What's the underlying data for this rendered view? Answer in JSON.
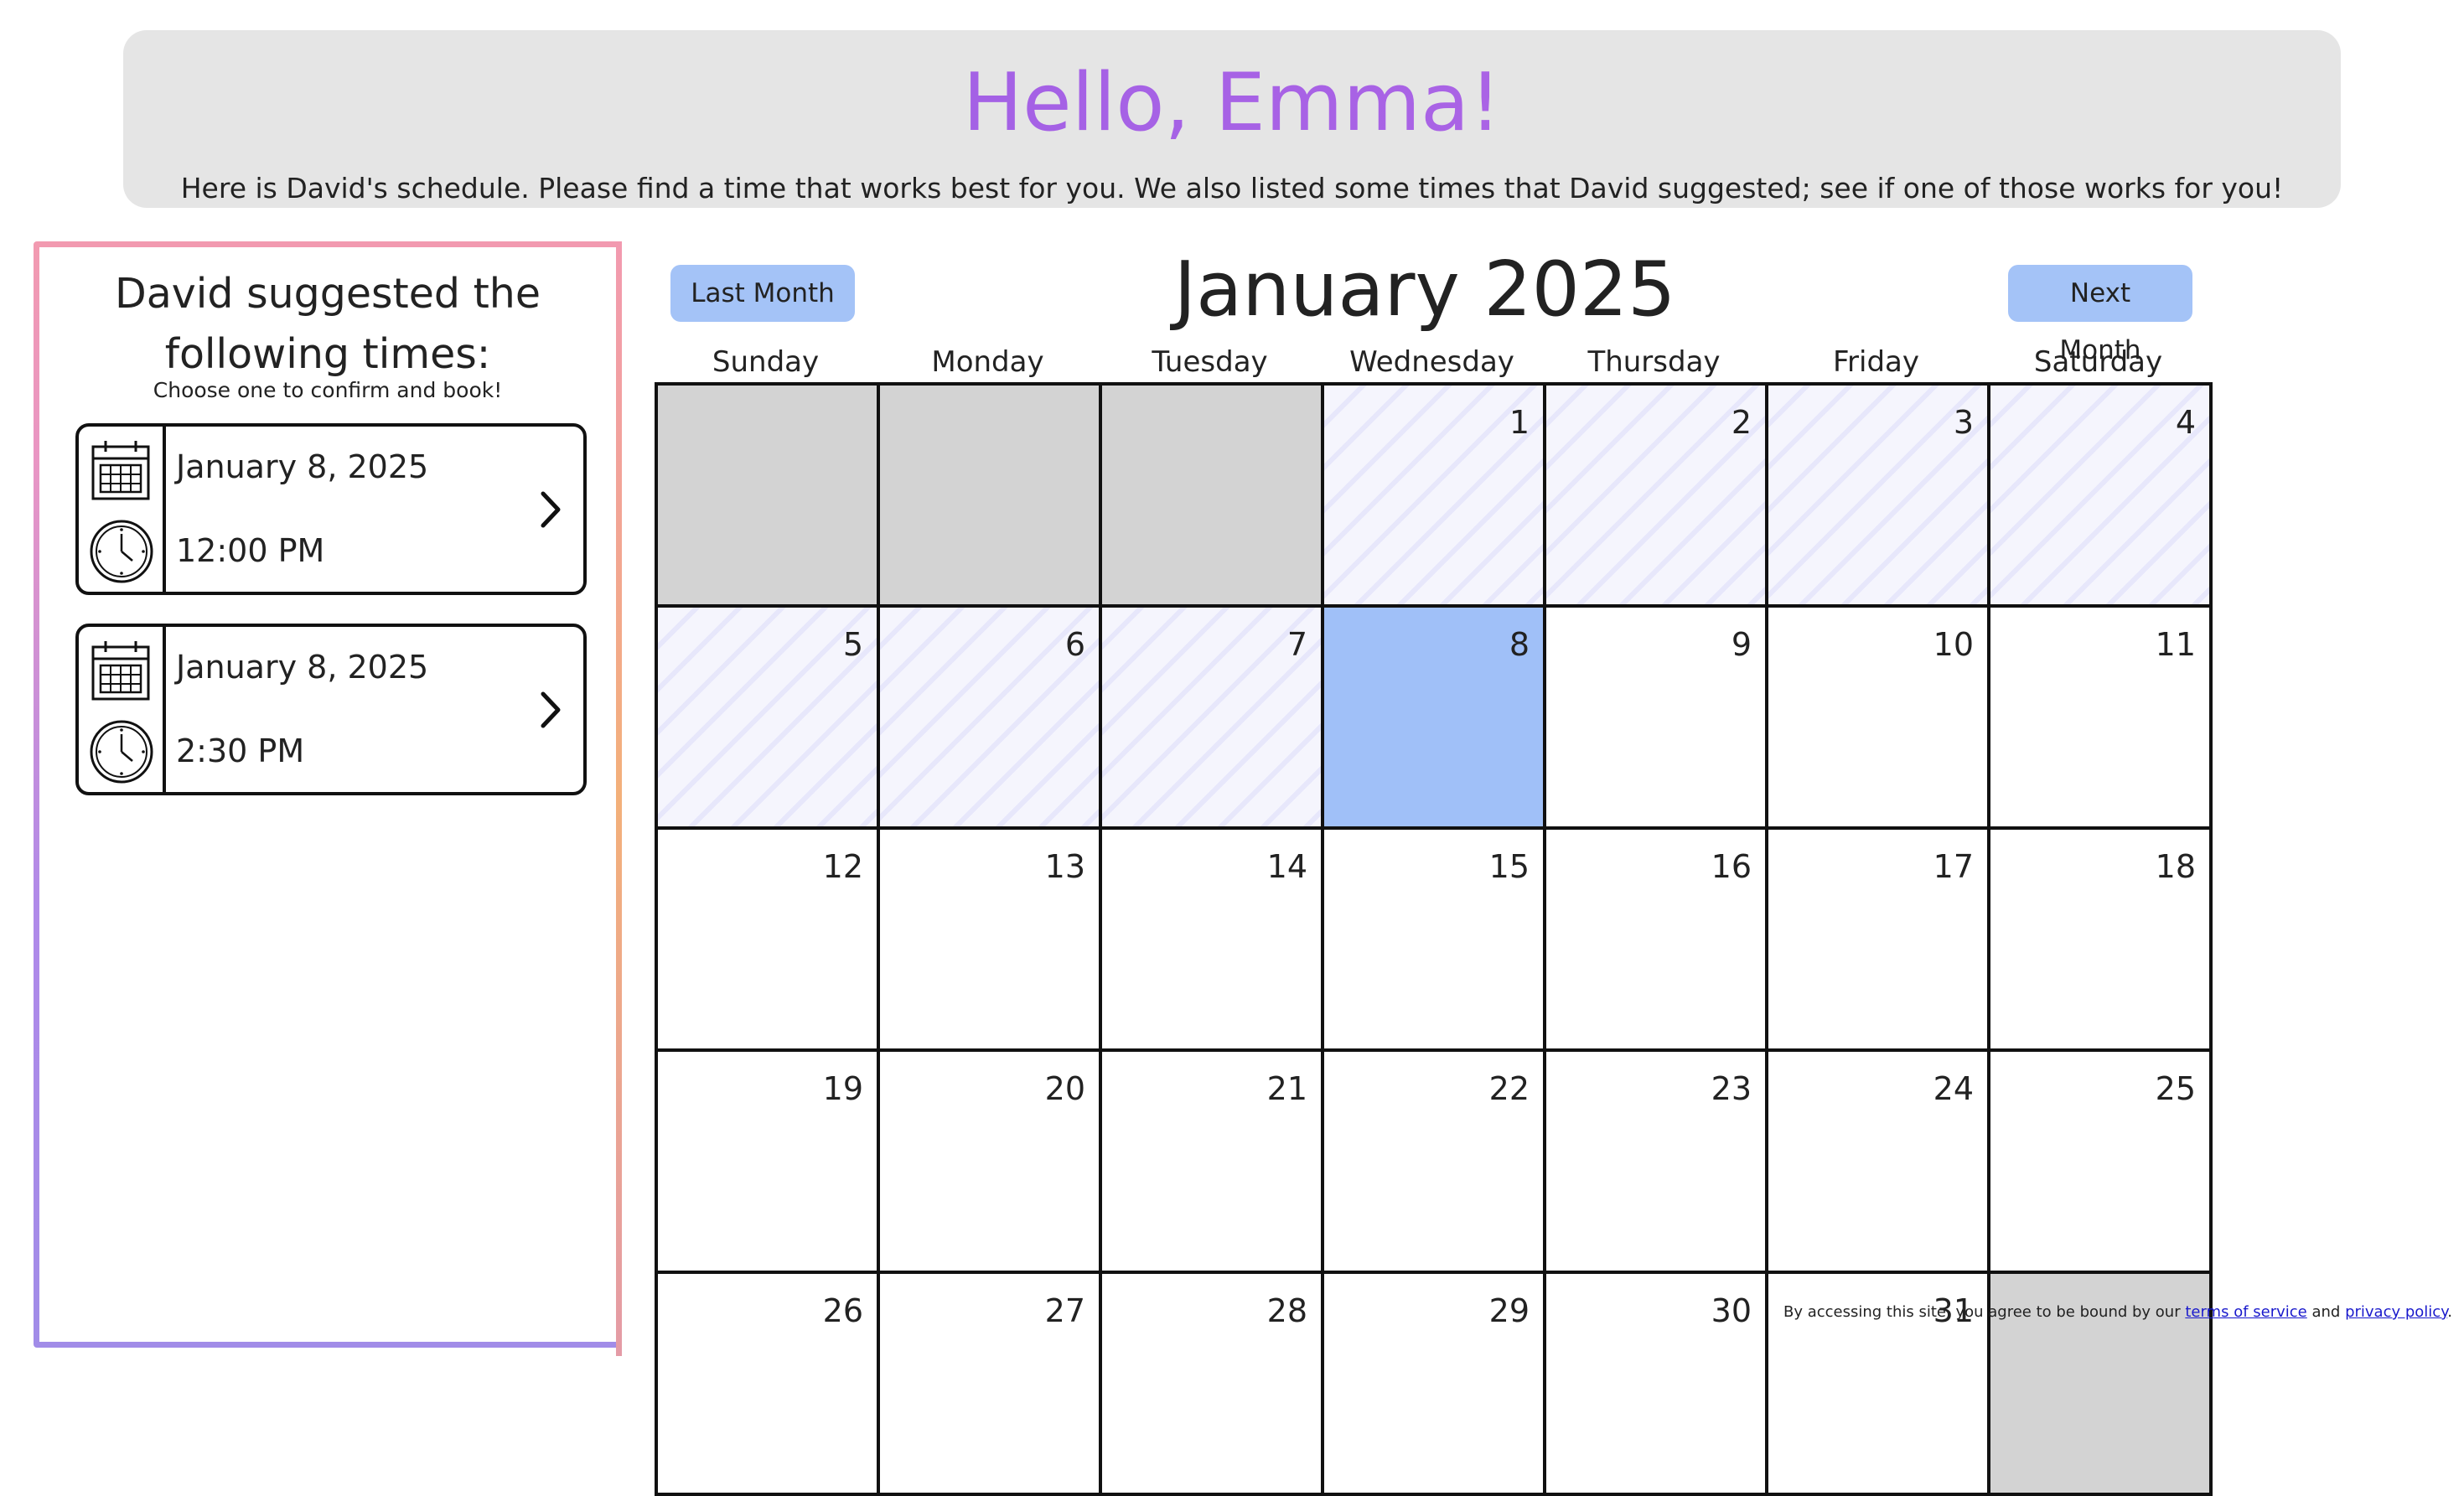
{
  "header": {
    "title": "Hello, Emma!",
    "subtitle": "Here is David's schedule. Please find a time that works best for you. We also listed some times that David suggested; see if one of those works for you!"
  },
  "sidebar": {
    "title": "David suggested the following times:",
    "subtitle": "Choose one to confirm and book!",
    "suggestions": [
      {
        "date": "January 8, 2025",
        "time": "12:00 PM",
        "icons": [
          "calendar-icon",
          "clock-icon",
          "chevron-right-icon"
        ]
      },
      {
        "date": "January 8, 2025",
        "time": "2:30 PM",
        "icons": [
          "calendar-icon",
          "clock-icon",
          "chevron-right-icon"
        ]
      }
    ]
  },
  "calendar": {
    "prev_label": "Last Month",
    "next_label": "Next Month",
    "month_title": "January 2025",
    "weekdays": [
      "Sunday",
      "Monday",
      "Tuesday",
      "Wednesday",
      "Thursday",
      "Friday",
      "Saturday"
    ],
    "leading_empty": 3,
    "past_days": [
      1,
      2,
      3,
      4,
      5,
      6,
      7
    ],
    "selected_day": 8,
    "visible_days": [
      1,
      2,
      3,
      4,
      5,
      6,
      7,
      8,
      9,
      10,
      11,
      12,
      13,
      14,
      15,
      16,
      17,
      18,
      19,
      20,
      21,
      22,
      23,
      24,
      25,
      26,
      27,
      28,
      29,
      30,
      31
    ],
    "colors": {
      "selected": "#a0c0f8",
      "empty": "#d3d3d3",
      "nav_button": "#a4c3f7",
      "title_gradient": "#9b5de5"
    }
  },
  "footer": {
    "prefix": "By accessing this site, you agree to be bound by our ",
    "terms_link": "terms of service",
    "middle": " and ",
    "privacy_link": "privacy policy",
    "suffix": "."
  }
}
